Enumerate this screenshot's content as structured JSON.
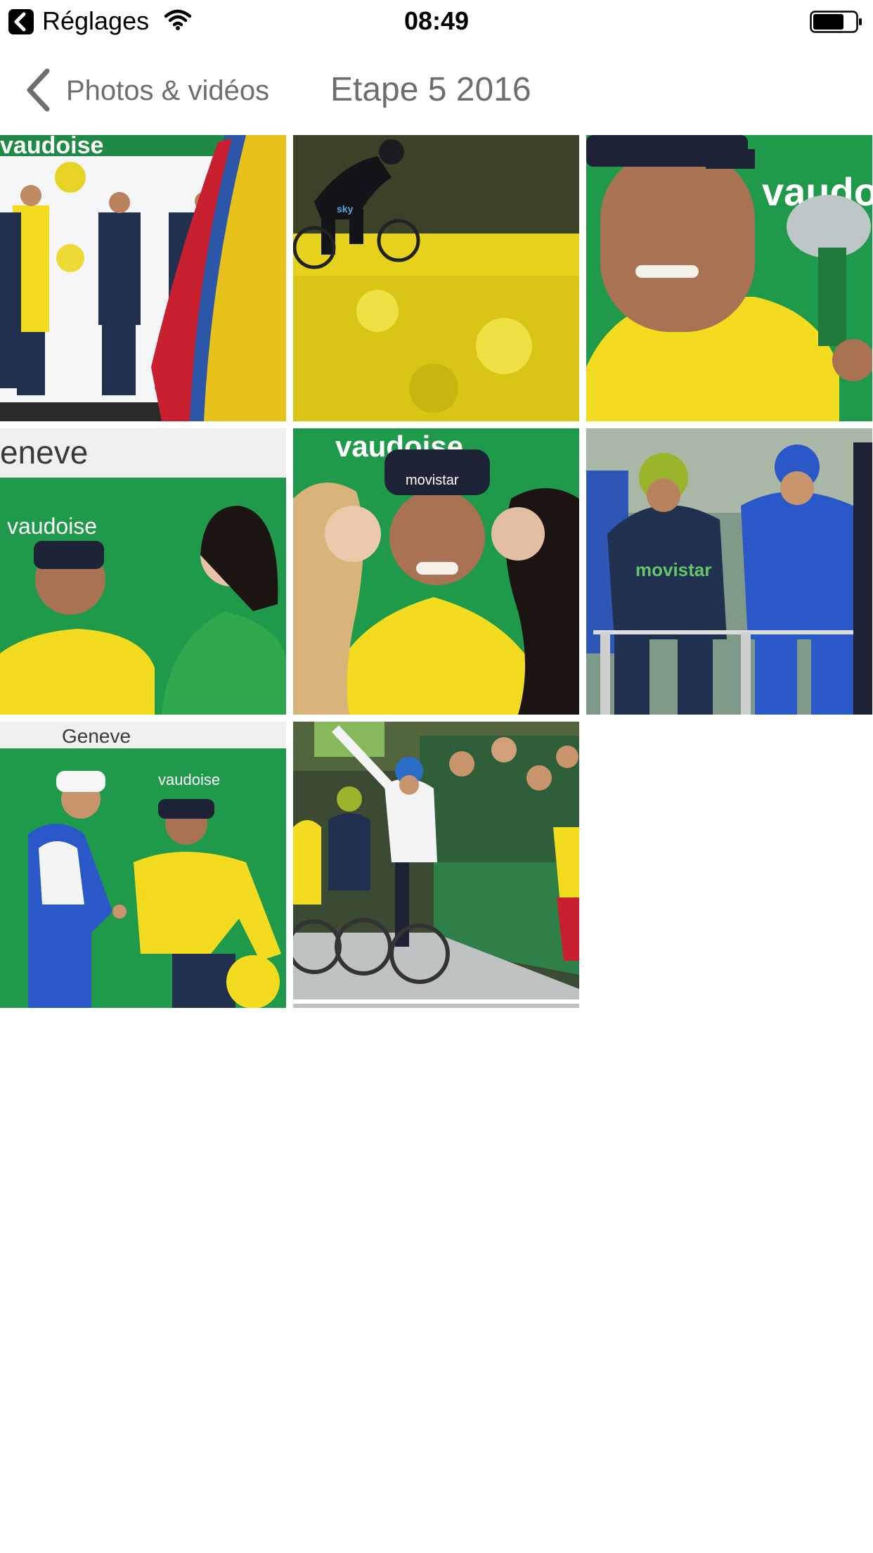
{
  "status_bar": {
    "back_app_label": "Réglages",
    "time": "08:49",
    "icons": [
      "back-arrow-icon",
      "wifi-icon",
      "battery-icon"
    ]
  },
  "nav_bar": {
    "back_label": "Photos & vidéos",
    "title": "Etape 5 2016",
    "icons": [
      "chevron-left-icon"
    ]
  },
  "photos": {
    "count": 8,
    "text": {
      "p1_banner": "vaudoise",
      "p2_banner": "sky",
      "p3_banner": "vaudoise",
      "p4_header": "eneve",
      "p4_banner": "vaudoise",
      "p5_banner": "vaudoise",
      "p5_cap": "movistar",
      "p6_jersey": "movistar",
      "p7_header": "Geneve",
      "p7_banner": "vaudoise"
    }
  },
  "colors": {
    "nav_text": "#6e6e6e",
    "vaudoise_green": "#1f9a4a",
    "leader_yellow": "#f3dc1f",
    "movistar_navy": "#22304f"
  }
}
